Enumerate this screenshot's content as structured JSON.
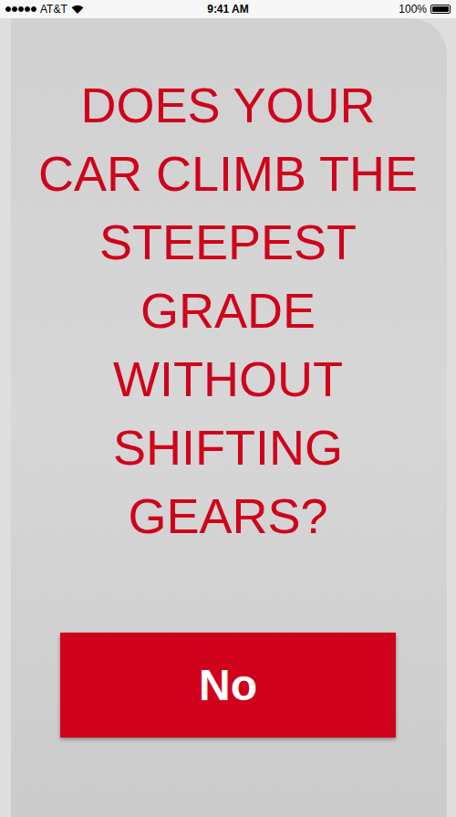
{
  "status_bar": {
    "carrier": "AT&T",
    "signal_level": 1,
    "time": "9:41 AM",
    "battery": "100%",
    "battery_level": 1
  },
  "heading": {
    "lines": [
      "DOES YOUR",
      "CAR CLIMB THE",
      "STEEPEST",
      "GRADE",
      "WITHOUT",
      "SHIFTING",
      "GEARS?"
    ]
  },
  "buttons": [
    {
      "label": "No"
    }
  ]
}
